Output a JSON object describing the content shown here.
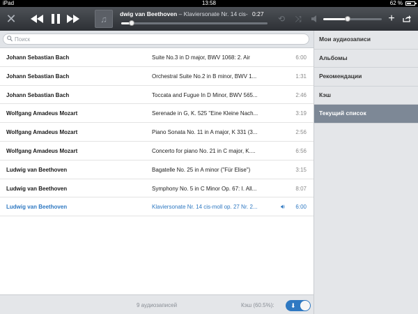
{
  "status_bar": {
    "carrier": "iPad",
    "time": "13:58",
    "battery": "62 %",
    "battery_level": 0.62
  },
  "player": {
    "now_playing_artist": "dwig van Beethoven",
    "now_playing_title": " – Klaviersonate Nr. 14 cis-",
    "elapsed": "0:27",
    "progress": 0.07,
    "volume": 0.42
  },
  "search": {
    "placeholder": "Поиск"
  },
  "tracks": [
    {
      "artist": "Johann Sebastian Bach",
      "title": "Suite No.3 in D major, BWV 1068: 2. Air",
      "duration": "6:00"
    },
    {
      "artist": "Johann Sebastian Bach",
      "title": "Orchestral Suite No.2 in B minor, BWV 1...",
      "duration": "1:31"
    },
    {
      "artist": "Johann Sebastian Bach",
      "title": "Toccata and Fugue In D Minor, BWV 565...",
      "duration": "2:46"
    },
    {
      "artist": "Wolfgang Amadeus Mozart",
      "title": "Serenade in G, K. 525 \"Eine Kleine Nach...",
      "duration": "3:19"
    },
    {
      "artist": "Wolfgang Amadeus Mozart",
      "title": "Piano Sonata No. 11 in A major, K 331 (3...",
      "duration": "2:56"
    },
    {
      "artist": "Wolfgang Amadeus Mozart",
      "title": "Concerto for piano No. 21 in C major, K....",
      "duration": "6:56"
    },
    {
      "artist": "Ludwig van Beethoven",
      "title": "Bagatelle No. 25 in A minor (\"Für Elise\")",
      "duration": "3:15"
    },
    {
      "artist": "Ludwig van Beethoven",
      "title": "Symphony No. 5 in C Minor Op. 67: I. All...",
      "duration": "8:07"
    },
    {
      "artist": "Ludwig van Beethoven",
      "title": "Klaviersonate Nr. 14 cis-moll op. 27 Nr. 2...",
      "duration": "6:00",
      "current": true
    }
  ],
  "sidebar": {
    "items": [
      {
        "label": "Мои аудиозаписи",
        "active": false
      },
      {
        "label": "Альбомы",
        "active": false
      },
      {
        "label": "Рекомендации",
        "active": false
      },
      {
        "label": "Кэш",
        "active": false
      },
      {
        "label": "Текущий список",
        "active": true
      }
    ]
  },
  "footer": {
    "count": "9 аудиозаписей",
    "cache_label": "Кэш (60.5%):",
    "cache_enabled": true
  },
  "colors": {
    "accent": "#2f79c2",
    "active_sidebar": "#7d8896",
    "toolbar": "#3a3d42"
  }
}
